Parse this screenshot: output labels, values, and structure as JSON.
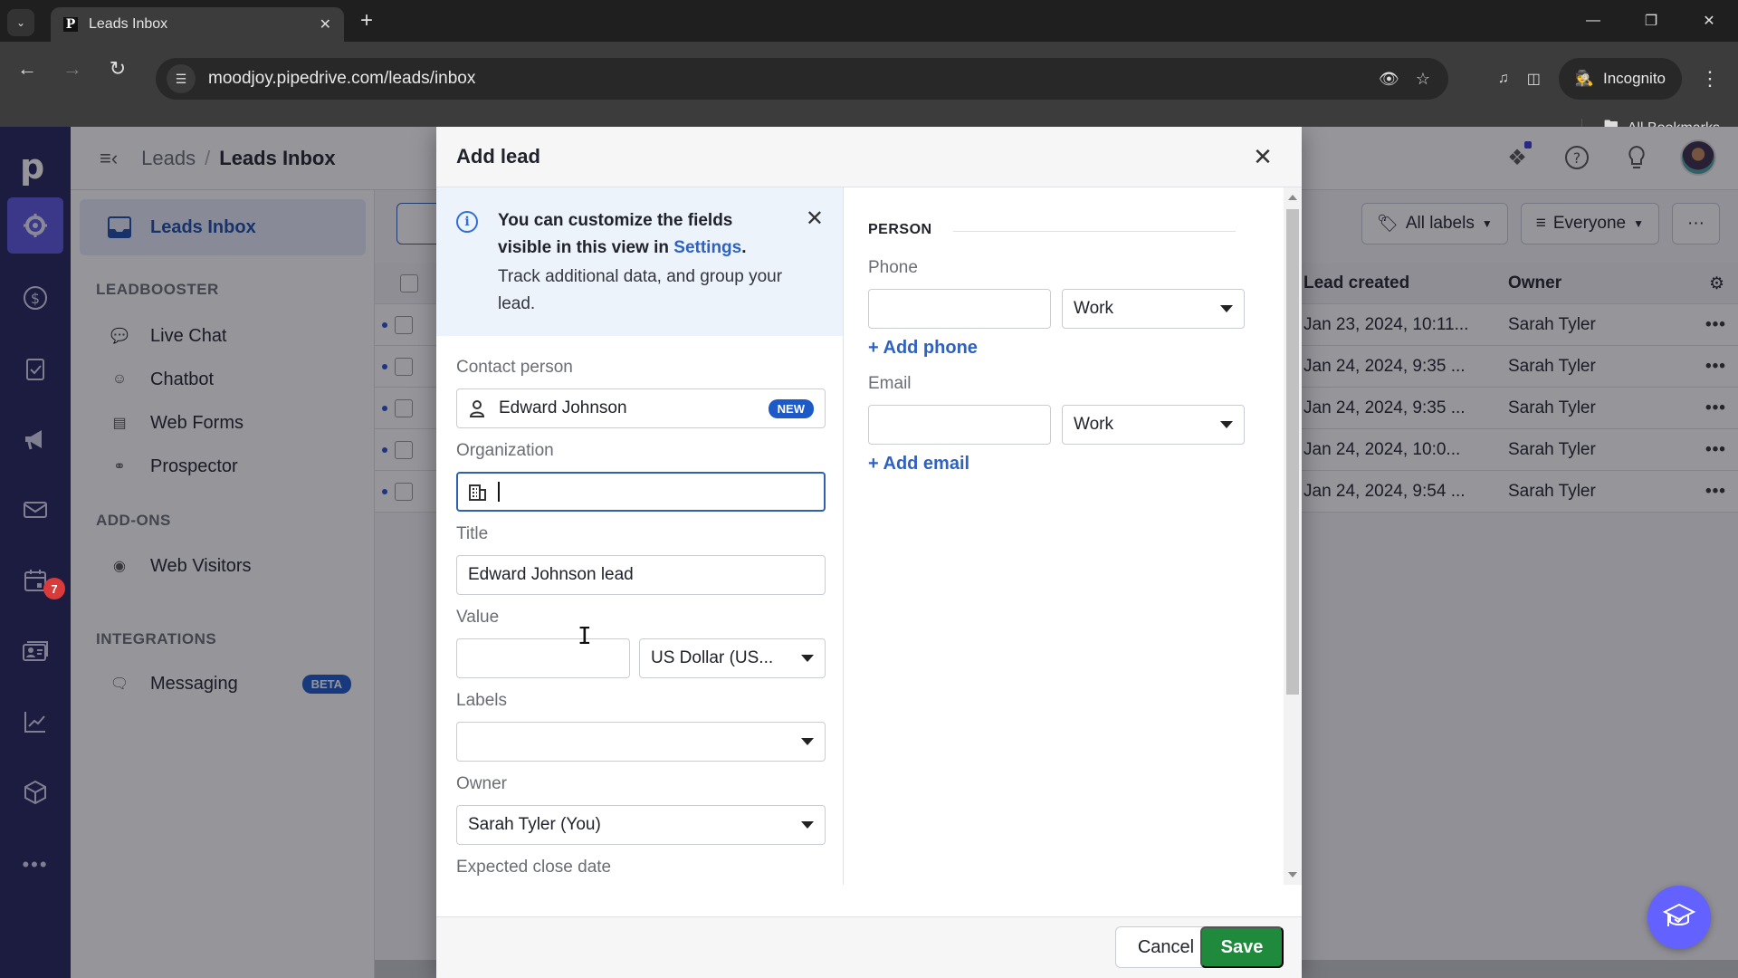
{
  "browser": {
    "tab_title": "Leads Inbox",
    "url": "moodjoy.pipedrive.com/leads/inbox",
    "incognito_label": "Incognito",
    "bookmarks_label": "All Bookmarks"
  },
  "app": {
    "logo": "p",
    "breadcrumb": {
      "parent": "Leads",
      "separator": "/",
      "current": "Leads Inbox"
    },
    "rail": {
      "items": [
        {
          "icon": "leads-target-icon",
          "active": true
        },
        {
          "icon": "deals-dollar-icon"
        },
        {
          "icon": "activities-clipboard-icon"
        },
        {
          "icon": "campaigns-megaphone-icon"
        },
        {
          "icon": "mail-icon"
        },
        {
          "icon": "calendar-icon",
          "badge": "7"
        },
        {
          "icon": "contacts-card-icon"
        },
        {
          "icon": "insights-chart-icon"
        },
        {
          "icon": "products-box-icon"
        },
        {
          "icon": "more-dots-icon"
        }
      ],
      "calendar_badge": "7"
    },
    "subnav": {
      "active_item": "Leads Inbox",
      "sections": [
        {
          "heading": "LEADBOOSTER",
          "items": [
            "Live Chat",
            "Chatbot",
            "Web Forms",
            "Prospector"
          ]
        },
        {
          "heading": "ADD-ONS",
          "items": [
            "Web Visitors"
          ]
        },
        {
          "heading": "INTEGRATIONS",
          "items": [
            "Messaging"
          ]
        }
      ],
      "beta_badge": "BETA"
    },
    "filters": {
      "labels": "All labels",
      "owner": "Everyone",
      "more": "···"
    },
    "table": {
      "columns": [
        "Lead created",
        "Owner"
      ],
      "rows": [
        {
          "created": "Jan 23, 2024, 10:11...",
          "owner": "Sarah Tyler"
        },
        {
          "created": "Jan 24, 2024, 9:35 ...",
          "owner": "Sarah Tyler"
        },
        {
          "created": "Jan 24, 2024, 9:35 ...",
          "owner": "Sarah Tyler"
        },
        {
          "created": "Jan 24, 2024, 10:0...",
          "owner": "Sarah Tyler"
        },
        {
          "created": "Jan 24, 2024, 9:54 ...",
          "owner": "Sarah Tyler"
        }
      ],
      "row_menu": "•••"
    }
  },
  "modal": {
    "title": "Add lead",
    "info": {
      "bold_text": "You can customize the fields visible in this view in ",
      "link": "Settings",
      "bold_suffix": ".",
      "text": "Track additional data, and group your lead."
    },
    "fields": {
      "contact_person": {
        "label": "Contact person",
        "value": "Edward Johnson",
        "badge": "NEW"
      },
      "organization": {
        "label": "Organization",
        "value": ""
      },
      "title": {
        "label": "Title",
        "value": "Edward Johnson lead"
      },
      "value": {
        "label": "Value",
        "value": "",
        "currency": "US Dollar (US..."
      },
      "labels": {
        "label": "Labels",
        "value": ""
      },
      "owner": {
        "label": "Owner",
        "value": "Sarah Tyler (You)"
      },
      "expected_close_date": {
        "label": "Expected close date"
      }
    },
    "person": {
      "section_title": "PERSON",
      "phone": {
        "label": "Phone",
        "value": "",
        "type": "Work",
        "add_link": "+ Add phone"
      },
      "email": {
        "label": "Email",
        "value": "",
        "type": "Work",
        "add_link": "+ Add email"
      }
    },
    "footer": {
      "cancel": "Cancel",
      "save": "Save"
    }
  },
  "colors": {
    "rail_bg": "#24245e",
    "rail_active": "#5c54e0",
    "link_blue": "#2e62c2",
    "save_green": "#1f8a3b",
    "badge_blue": "#1d5ac8",
    "fab_purple": "#6361ff"
  }
}
